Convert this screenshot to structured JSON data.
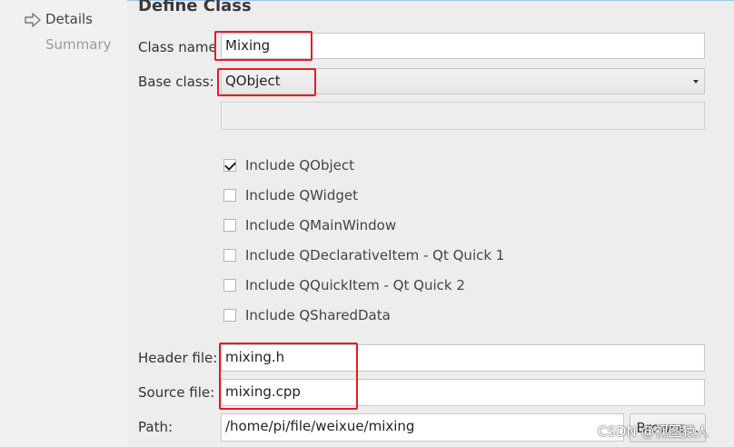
{
  "sidebar": {
    "items": [
      {
        "label": "Details"
      },
      {
        "label": "Summary"
      }
    ]
  },
  "page": {
    "title": "Define Class"
  },
  "form": {
    "class_name": {
      "label": "Class name",
      "value": "Mixing"
    },
    "base_class": {
      "label": "Base class:",
      "value": "QObject"
    },
    "checkboxes": [
      {
        "label": "Include QObject",
        "checked": true
      },
      {
        "label": "Include QWidget",
        "checked": false
      },
      {
        "label": "Include QMainWindow",
        "checked": false
      },
      {
        "label": "Include QDeclarativeItem - Qt Quick 1",
        "checked": false
      },
      {
        "label": "Include QQuickItem - Qt Quick 2",
        "checked": false
      },
      {
        "label": "Include QSharedData",
        "checked": false
      }
    ],
    "header_file": {
      "label": "Header file:",
      "value": "mixing.h"
    },
    "source_file": {
      "label": "Source file:",
      "value": "mixing.cpp"
    },
    "path": {
      "label": "Path:",
      "value": "/home/pi/file/weixue/mixing"
    },
    "browse_label": "Browse..."
  },
  "watermark": "CSDN @视图猿人",
  "colors": {
    "highlight_box": "#e51c23",
    "background": "#ededed"
  }
}
